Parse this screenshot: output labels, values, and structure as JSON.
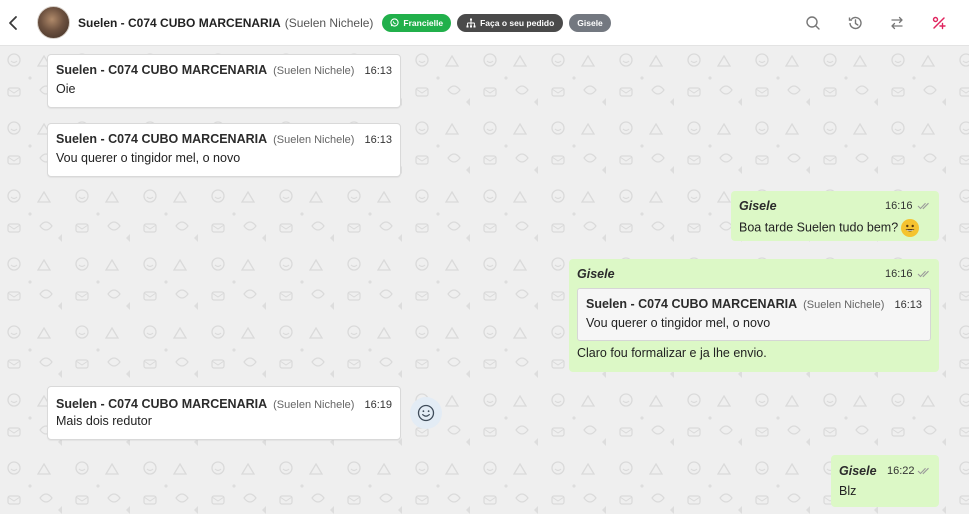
{
  "header": {
    "contact_name": "Suelen - C074 CUBO MARCENARIA",
    "contact_sub": "(Suelen Nichele)",
    "tags": [
      {
        "label": "Francielle",
        "icon": "whatsapp-icon",
        "color": "#21b04b"
      },
      {
        "label": "Faça o seu pedido",
        "icon": "org-chart-icon",
        "color": "#4a4a4a"
      },
      {
        "label": "Gisele",
        "color": "#737880"
      }
    ],
    "actions": [
      "search-icon",
      "history-icon",
      "transfer-icon",
      "close-ticket-icon"
    ],
    "accent_color": "#e0245e"
  },
  "messages": [
    {
      "direction": "in",
      "sender": "Suelen - C074 CUBO MARCENARIA",
      "sender_sub": "(Suelen Nichele)",
      "time": "16:13",
      "text": "Oie"
    },
    {
      "direction": "in",
      "sender": "Suelen - C074 CUBO MARCENARIA",
      "sender_sub": "(Suelen Nichele)",
      "time": "16:13",
      "text": "Vou querer o tingidor mel, o novo"
    },
    {
      "direction": "out",
      "sender": "Gisele",
      "time": "16:16",
      "text": "Boa tarde Suelen tudo bem?"
    },
    {
      "direction": "out",
      "sender": "Gisele",
      "time": "16:16",
      "quote": {
        "sender": "Suelen - C074 CUBO MARCENARIA",
        "sender_sub": "(Suelen Nichele)",
        "time": "16:13",
        "text": "Vou querer o tingidor mel, o novo"
      },
      "text": "Claro fou formalizar e ja lhe envio."
    },
    {
      "direction": "in",
      "sender": "Suelen - C074 CUBO MARCENARIA",
      "sender_sub": "(Suelen Nichele)",
      "time": "16:19",
      "text": "Mais dois redutor"
    },
    {
      "direction": "out",
      "sender": "Gisele",
      "time": "16:22",
      "text": "Blz"
    }
  ],
  "colors": {
    "incoming_bg": "#ffffff",
    "outgoing_bg": "#dcf8c6",
    "chat_bg": "#efefef"
  }
}
